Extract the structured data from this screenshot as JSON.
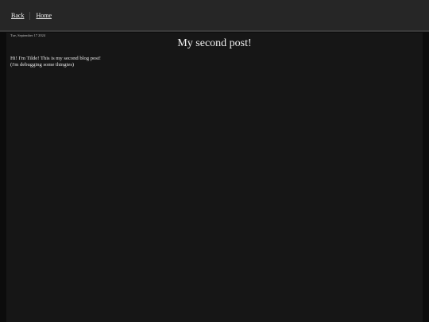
{
  "nav": {
    "back_label": "Back",
    "home_label": "Home"
  },
  "post": {
    "date": "Tue, September 17 2024",
    "title": "My second post!",
    "lines": [
      "Hi! I'm Tilde! This is my second blog post!",
      "(i'm debugging some thingies)"
    ]
  },
  "colors": {
    "topbar": "#262626",
    "page_background": "#0c0c0c",
    "content_background": "#161616",
    "text": "#e6e6e6"
  }
}
